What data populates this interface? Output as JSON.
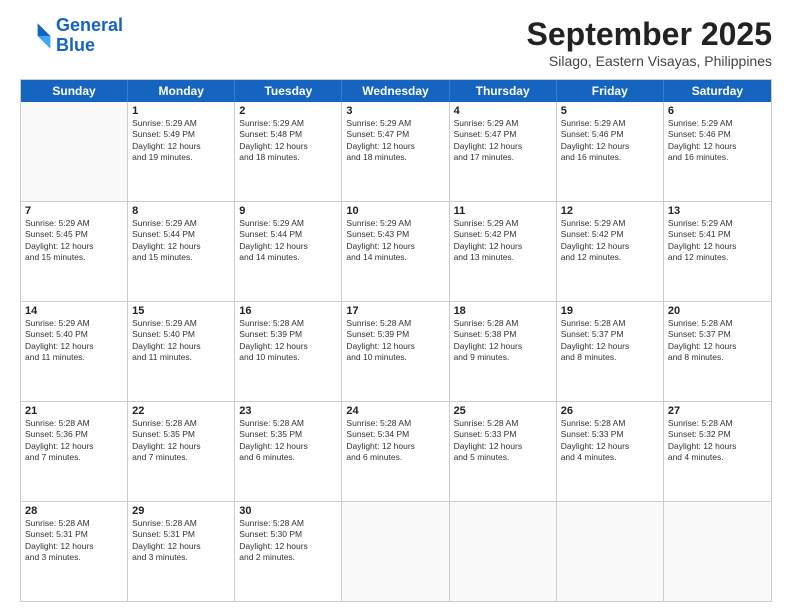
{
  "logo": {
    "line1": "General",
    "line2": "Blue"
  },
  "header": {
    "month_year": "September 2025",
    "location": "Silago, Eastern Visayas, Philippines"
  },
  "weekdays": [
    "Sunday",
    "Monday",
    "Tuesday",
    "Wednesday",
    "Thursday",
    "Friday",
    "Saturday"
  ],
  "rows": [
    [
      {
        "day": "",
        "info": ""
      },
      {
        "day": "1",
        "info": "Sunrise: 5:29 AM\nSunset: 5:49 PM\nDaylight: 12 hours\nand 19 minutes."
      },
      {
        "day": "2",
        "info": "Sunrise: 5:29 AM\nSunset: 5:48 PM\nDaylight: 12 hours\nand 18 minutes."
      },
      {
        "day": "3",
        "info": "Sunrise: 5:29 AM\nSunset: 5:47 PM\nDaylight: 12 hours\nand 18 minutes."
      },
      {
        "day": "4",
        "info": "Sunrise: 5:29 AM\nSunset: 5:47 PM\nDaylight: 12 hours\nand 17 minutes."
      },
      {
        "day": "5",
        "info": "Sunrise: 5:29 AM\nSunset: 5:46 PM\nDaylight: 12 hours\nand 16 minutes."
      },
      {
        "day": "6",
        "info": "Sunrise: 5:29 AM\nSunset: 5:46 PM\nDaylight: 12 hours\nand 16 minutes."
      }
    ],
    [
      {
        "day": "7",
        "info": "Sunrise: 5:29 AM\nSunset: 5:45 PM\nDaylight: 12 hours\nand 15 minutes."
      },
      {
        "day": "8",
        "info": "Sunrise: 5:29 AM\nSunset: 5:44 PM\nDaylight: 12 hours\nand 15 minutes."
      },
      {
        "day": "9",
        "info": "Sunrise: 5:29 AM\nSunset: 5:44 PM\nDaylight: 12 hours\nand 14 minutes."
      },
      {
        "day": "10",
        "info": "Sunrise: 5:29 AM\nSunset: 5:43 PM\nDaylight: 12 hours\nand 14 minutes."
      },
      {
        "day": "11",
        "info": "Sunrise: 5:29 AM\nSunset: 5:42 PM\nDaylight: 12 hours\nand 13 minutes."
      },
      {
        "day": "12",
        "info": "Sunrise: 5:29 AM\nSunset: 5:42 PM\nDaylight: 12 hours\nand 12 minutes."
      },
      {
        "day": "13",
        "info": "Sunrise: 5:29 AM\nSunset: 5:41 PM\nDaylight: 12 hours\nand 12 minutes."
      }
    ],
    [
      {
        "day": "14",
        "info": "Sunrise: 5:29 AM\nSunset: 5:40 PM\nDaylight: 12 hours\nand 11 minutes."
      },
      {
        "day": "15",
        "info": "Sunrise: 5:29 AM\nSunset: 5:40 PM\nDaylight: 12 hours\nand 11 minutes."
      },
      {
        "day": "16",
        "info": "Sunrise: 5:28 AM\nSunset: 5:39 PM\nDaylight: 12 hours\nand 10 minutes."
      },
      {
        "day": "17",
        "info": "Sunrise: 5:28 AM\nSunset: 5:39 PM\nDaylight: 12 hours\nand 10 minutes."
      },
      {
        "day": "18",
        "info": "Sunrise: 5:28 AM\nSunset: 5:38 PM\nDaylight: 12 hours\nand 9 minutes."
      },
      {
        "day": "19",
        "info": "Sunrise: 5:28 AM\nSunset: 5:37 PM\nDaylight: 12 hours\nand 8 minutes."
      },
      {
        "day": "20",
        "info": "Sunrise: 5:28 AM\nSunset: 5:37 PM\nDaylight: 12 hours\nand 8 minutes."
      }
    ],
    [
      {
        "day": "21",
        "info": "Sunrise: 5:28 AM\nSunset: 5:36 PM\nDaylight: 12 hours\nand 7 minutes."
      },
      {
        "day": "22",
        "info": "Sunrise: 5:28 AM\nSunset: 5:35 PM\nDaylight: 12 hours\nand 7 minutes."
      },
      {
        "day": "23",
        "info": "Sunrise: 5:28 AM\nSunset: 5:35 PM\nDaylight: 12 hours\nand 6 minutes."
      },
      {
        "day": "24",
        "info": "Sunrise: 5:28 AM\nSunset: 5:34 PM\nDaylight: 12 hours\nand 6 minutes."
      },
      {
        "day": "25",
        "info": "Sunrise: 5:28 AM\nSunset: 5:33 PM\nDaylight: 12 hours\nand 5 minutes."
      },
      {
        "day": "26",
        "info": "Sunrise: 5:28 AM\nSunset: 5:33 PM\nDaylight: 12 hours\nand 4 minutes."
      },
      {
        "day": "27",
        "info": "Sunrise: 5:28 AM\nSunset: 5:32 PM\nDaylight: 12 hours\nand 4 minutes."
      }
    ],
    [
      {
        "day": "28",
        "info": "Sunrise: 5:28 AM\nSunset: 5:31 PM\nDaylight: 12 hours\nand 3 minutes."
      },
      {
        "day": "29",
        "info": "Sunrise: 5:28 AM\nSunset: 5:31 PM\nDaylight: 12 hours\nand 3 minutes."
      },
      {
        "day": "30",
        "info": "Sunrise: 5:28 AM\nSunset: 5:30 PM\nDaylight: 12 hours\nand 2 minutes."
      },
      {
        "day": "",
        "info": ""
      },
      {
        "day": "",
        "info": ""
      },
      {
        "day": "",
        "info": ""
      },
      {
        "day": "",
        "info": ""
      }
    ]
  ]
}
